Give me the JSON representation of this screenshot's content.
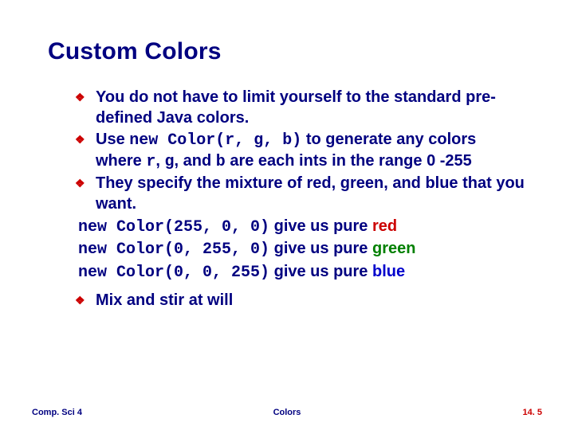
{
  "title": "Custom Colors",
  "bullets": {
    "b1": "You do not have to limit yourself to the standard pre-defined Java colors.",
    "b2_a": "Use ",
    "b2_code": "new Color(r, g, b)",
    "b2_b": " to generate any colors where ",
    "b2_r": "r",
    "b2_c": ", ",
    "b2_g": "g",
    "b2_d": ", and ",
    "b2_bvar": "b",
    "b2_e": " are each ints in the range 0 -255",
    "b3": " They specify the mixture of red, green, and blue that you want.",
    "b4": "Mix and stir at will"
  },
  "examples": {
    "e1_code": "new Color(255, 0, 0)",
    "e1_txt": " give us pure ",
    "e1_clr": "red",
    "e2_code": "new Color(0, 255, 0)",
    "e2_txt": " give us pure ",
    "e2_clr": "green",
    "e3_code": "new Color(0, 0, 255)",
    "e3_txt": " give us pure ",
    "e3_clr": "blue"
  },
  "footer": {
    "left": "Comp. Sci 4",
    "center": "Colors",
    "right": "14. 5"
  },
  "glyphs": {
    "diamond": "❖"
  }
}
